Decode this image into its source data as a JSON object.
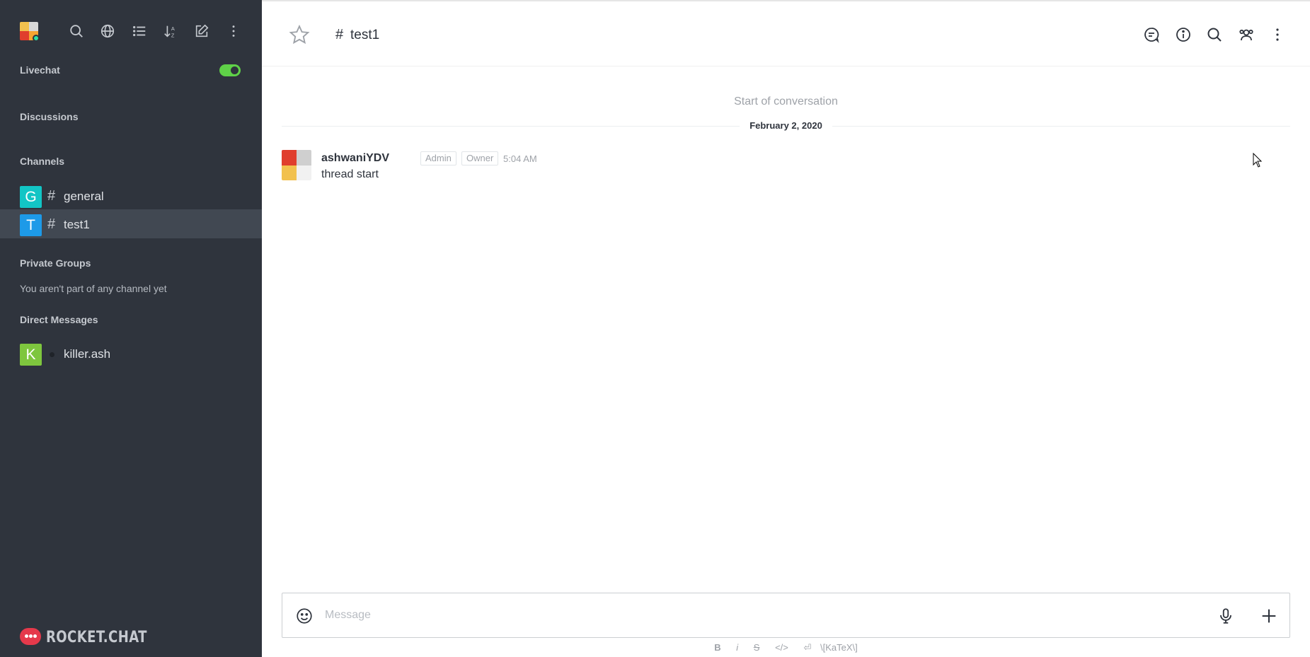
{
  "sidebar": {
    "livechat_label": "Livechat",
    "livechat_enabled": true,
    "discussions_label": "Discussions",
    "channels_label": "Channels",
    "channels": [
      {
        "initial": "G",
        "name": "general",
        "color": "#12c5c5"
      },
      {
        "initial": "T",
        "name": "test1",
        "color": "#1d9ae8"
      }
    ],
    "private_groups_label": "Private Groups",
    "private_groups_empty": "You aren't part of any channel yet",
    "direct_messages_label": "Direct Messages",
    "direct_messages": [
      {
        "initial": "K",
        "name": "killer.ash",
        "color": "#7ec63e"
      }
    ],
    "brand": "ROCKET.CHAT",
    "icons": [
      "search-icon",
      "directory-globe-icon",
      "view-mode-list-icon",
      "sort-icon",
      "create-new-icon",
      "kebab-menu-icon"
    ]
  },
  "room": {
    "hash": "#",
    "title": "test1",
    "header_icons": [
      "threads-icon",
      "room-info-icon",
      "search-messages-icon",
      "members-icon",
      "kebab-menu-icon"
    ]
  },
  "conversation": {
    "start_label": "Start of conversation",
    "date_label": "February 2, 2020",
    "messages": [
      {
        "username": "ashwaniYDV",
        "roles": [
          "Admin",
          "Owner"
        ],
        "time": "5:04 AM",
        "text": "thread start"
      }
    ]
  },
  "composer": {
    "placeholder": "Message",
    "formatting": [
      "B",
      "i",
      "S",
      "</>",
      "⏎",
      "\\[KaTeX\\]"
    ]
  },
  "colors": {
    "sidebar_bg": "#2f343d",
    "active_room_bg": "#414852",
    "toggle_on": "#5fd148",
    "brand_red": "#e5394b"
  }
}
